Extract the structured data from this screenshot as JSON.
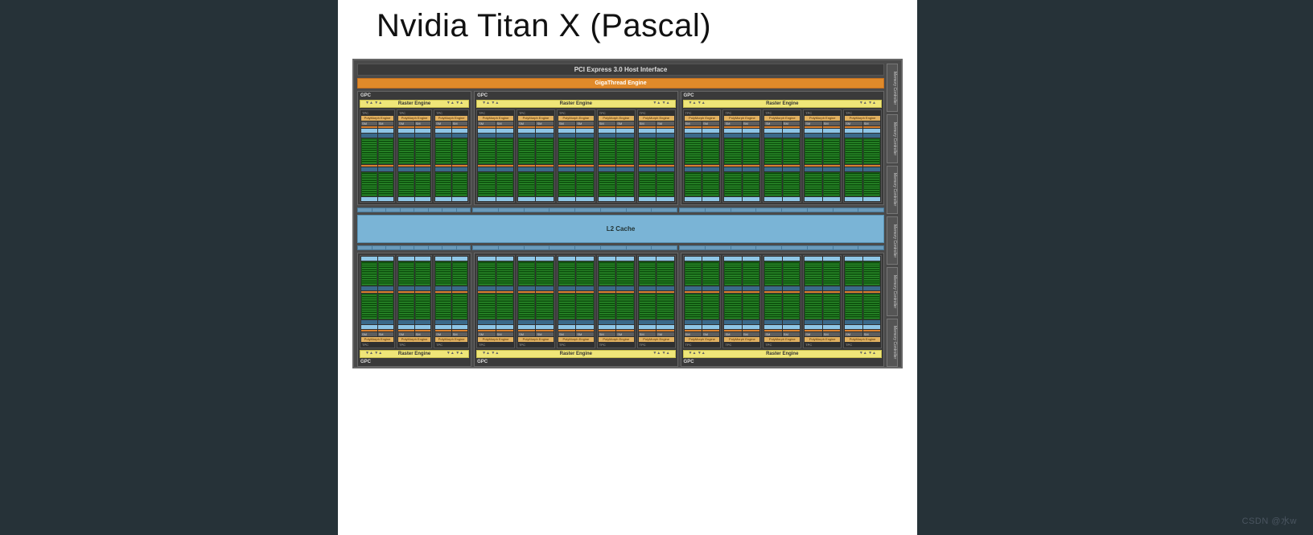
{
  "title": "Nvidia Titan X (Pascal)",
  "pci_label": "PCI Express 3.0 Host Interface",
  "giga_label": "GigaThread Engine",
  "l2_label": "L2 Cache",
  "gpc_label": "GPC",
  "raster_label": "Raster Engine",
  "tpc_label": "TPC",
  "polymorph_label": "PolyMorph Engine",
  "sm_label": "SM",
  "mem_label": "Memory Controller",
  "mem_controllers_per_side": 6,
  "gpc_count_per_row": 3,
  "tpc_per_gpc": 5,
  "partial_gpc_tpc": 3,
  "watermark": "CSDN @水w"
}
